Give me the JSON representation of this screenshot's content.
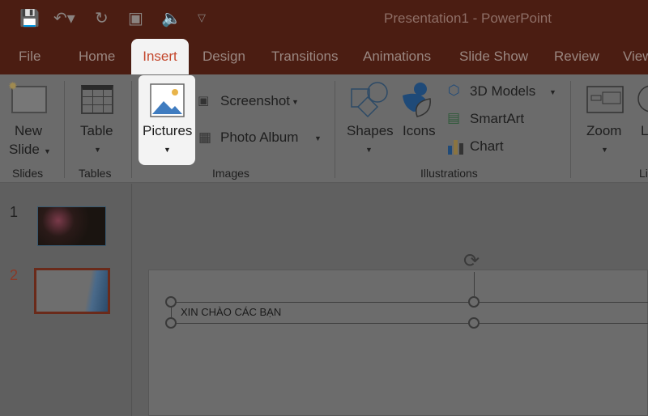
{
  "app": {
    "title": "Presentation1  -  PowerPoint"
  },
  "quick_access": [
    {
      "icon": "save-icon"
    },
    {
      "icon": "undo-icon"
    },
    {
      "icon": "redo-icon"
    },
    {
      "icon": "present-icon"
    },
    {
      "icon": "audio-icon"
    },
    {
      "icon": "customize-icon"
    }
  ],
  "tabs": {
    "file": "File",
    "home": "Home",
    "insert": "Insert",
    "design": "Design",
    "transitions": "Transitions",
    "animations": "Animations",
    "slideshow": "Slide Show",
    "review": "Review",
    "view": "View"
  },
  "ribbon": {
    "new_slide": "New",
    "new_slide2": "Slide",
    "table": "Table",
    "pictures": "Pictures",
    "screenshot": "Screenshot",
    "photo_album": "Photo Album",
    "shapes": "Shapes",
    "icons": "Icons",
    "models": "3D Models",
    "smartart": "SmartArt",
    "chart": "Chart",
    "zoom": "Zoom",
    "link": "L",
    "groups": {
      "slides": "Slides",
      "tables": "Tables",
      "images": "Images",
      "illustrations": "Illustrations",
      "links": "Li"
    }
  },
  "thumbnails": [
    {
      "number": "1"
    },
    {
      "number": "2",
      "selected": true
    }
  ],
  "slide": {
    "text": "XIN CHÀO CÁC BẠN"
  },
  "colors": {
    "accent": "#c4472c",
    "titlebar": "#4b1d12"
  }
}
